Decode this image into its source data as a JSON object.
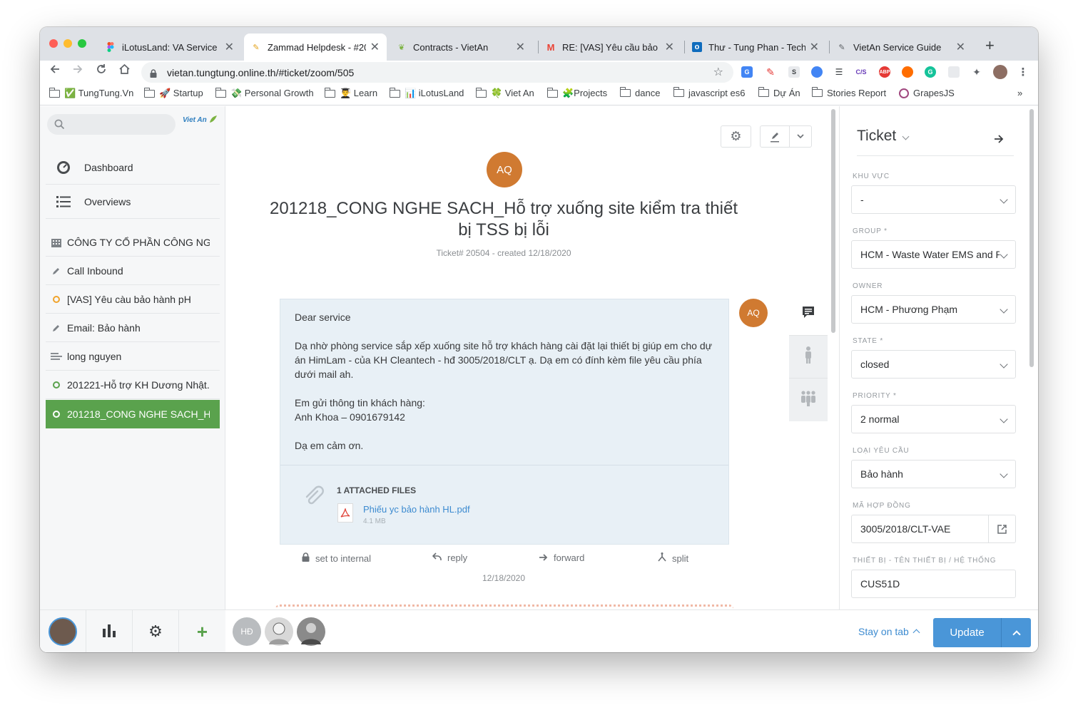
{
  "browser": {
    "tabs": [
      {
        "label": "iLotusLand: VA Service U",
        "icon": "figma-icon",
        "color": "#a259ff"
      },
      {
        "label": "Zammad Helpdesk - #20",
        "icon": "zammad-icon",
        "color": "#e3a21a"
      },
      {
        "label": "Contracts - VietAn",
        "icon": "leaf-icon",
        "color": "#7cb342"
      },
      {
        "label": "RE: [VAS] Yêu cầu bảo hà",
        "icon": "gmail-icon",
        "color": "#ea4335"
      },
      {
        "label": "Thư - Tung Phan - Techn",
        "icon": "outlook-icon",
        "color": "#0f6cbd"
      },
      {
        "label": "VietAn Service Guide",
        "icon": "guide-icon",
        "color": "#5f6368"
      }
    ],
    "url": "vietan.tungtung.online.th/#ticket/zoom/505",
    "bookmarks": [
      "✅ TungTung.Vn",
      "🚀 Startup",
      "💸 Personal Growth",
      "👨‍🎓 Learn",
      "📊 iLotusLand",
      "🍀 Viet An",
      "🧩Projects",
      "dance",
      "javascript es6",
      "Dự Án",
      "Stories Report",
      "GrapesJS"
    ],
    "bookmarks_more": "»"
  },
  "sidebar": {
    "search_placeholder": "",
    "logo_text": "Viet An",
    "main_nav": [
      {
        "label": "Dashboard",
        "icon": "dashboard-icon"
      },
      {
        "label": "Overviews",
        "icon": "list-icon"
      }
    ],
    "items": [
      {
        "label": "CÔNG TY CỔ PHẦN CÔNG NGH...",
        "icon": "building-icon",
        "color": "#7d8287"
      },
      {
        "label": "Call Inbound",
        "icon": "pencil-icon",
        "color": "#7d8287"
      },
      {
        "label": "[VAS] Yêu càu bảo hành pH",
        "icon": "open-ring-icon",
        "color": "#f0a32b"
      },
      {
        "label": "Email: Bảo hành",
        "icon": "pencil-icon",
        "color": "#7d8287"
      },
      {
        "label": "long nguyen",
        "icon": "card-icon",
        "color": "#7d8287"
      },
      {
        "label": "201221-Hỗ trợ KH Dương Nhật...",
        "icon": "closed-ring-icon",
        "color": "#5aa24d"
      },
      {
        "label": "201218_CONG NGHE SACH_Hỗ...",
        "icon": "closed-ring-icon",
        "color": "#ffffff"
      }
    ]
  },
  "ticket": {
    "avatar": "AQ",
    "title": "201218_CONG NGHE SACH_Hỗ trợ xuống site kiểm tra thiết bị TSS bị lỗi",
    "meta": "Ticket# 20504 - created 12/18/2020",
    "article": {
      "avatar": "AQ",
      "lines": [
        "Dear service",
        "",
        "Dạ nhờ phòng service sắp xếp  xuống site hỗ trợ khách hàng cài đặt lại thiết bị giúp em cho dự án HimLam - của KH Cleantech - hđ 3005/2018/CLT ạ. Dạ em có đính kèm file yêu cầu phía dưới mail ah.",
        "",
        "Em gửi thông tin khách hàng:",
        "Anh Khoa – 0901679142",
        "",
        "Dạ em cảm ơn."
      ],
      "attachments_header": "1 ATTACHED FILES",
      "file_name": "Phiếu yc bảo hành HL.pdf",
      "file_size": "4.1 MB"
    },
    "actions": [
      "set to internal",
      "reply",
      "forward",
      "split"
    ],
    "date": "12/18/2020"
  },
  "bottom": {
    "agents": [
      "HĐ",
      "",
      ""
    ],
    "stay_on_tab": "Stay on tab",
    "update_label": "Update"
  },
  "panel": {
    "title": "Ticket",
    "fields": [
      {
        "label": "KHU VỰC",
        "value": "-",
        "type": "select"
      },
      {
        "label": "GROUP *",
        "value": "HCM - Waste Water EMS and Pr",
        "type": "select"
      },
      {
        "label": "OWNER",
        "value": "HCM - Phương Phạm",
        "type": "select"
      },
      {
        "label": "STATE *",
        "value": "closed",
        "type": "select"
      },
      {
        "label": "PRIORITY *",
        "value": "2 normal",
        "type": "select"
      },
      {
        "label": "LOẠI YÊU CẦU",
        "value": "Bảo hành",
        "type": "select"
      },
      {
        "label": "MÃ HỢP ĐỒNG",
        "value": "3005/2018/CLT-VAE",
        "type": "link"
      },
      {
        "label": "THIẾT BỊ - TÊN THIẾT BỊ / HỆ THỐNG",
        "value": "CUS51D",
        "type": "text"
      }
    ]
  },
  "colors": {
    "accent_green": "#5aa24d",
    "avatar_orange": "#d07a31",
    "update_blue": "#4a96d8",
    "link_blue": "#3d8bd0"
  }
}
